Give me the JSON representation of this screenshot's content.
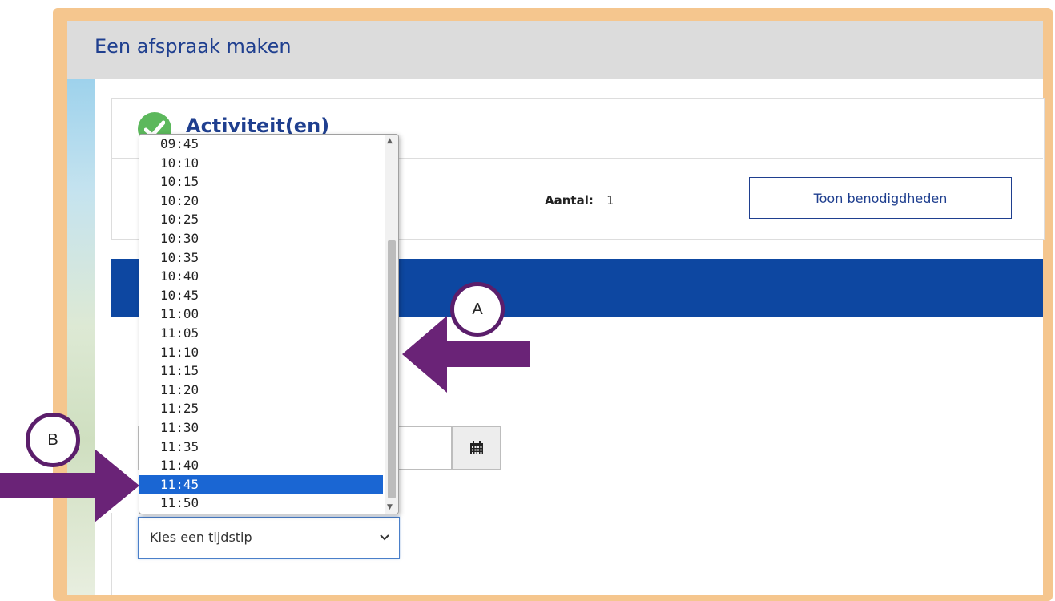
{
  "window": {
    "title": "Een afspraak maken"
  },
  "activities": {
    "title": "Activiteit(en)",
    "aantal_label": "Aantal:",
    "aantal_value": "1",
    "toon_button": "Toon benodigdheden"
  },
  "time_select": {
    "placeholder": "Kies een tijdstip",
    "options": [
      "09:45",
      "10:10",
      "10:15",
      "10:20",
      "10:25",
      "10:30",
      "10:35",
      "10:40",
      "10:45",
      "11:00",
      "11:05",
      "11:10",
      "11:15",
      "11:20",
      "11:25",
      "11:30",
      "11:35",
      "11:40",
      "11:45",
      "11:50"
    ],
    "highlighted": "11:45"
  },
  "annotations": {
    "marker_a": "A",
    "marker_b": "B"
  },
  "icons": {
    "check": "check-circle-icon",
    "calendar": "calendar-icon",
    "chevron": "chevron-down-icon"
  },
  "colors": {
    "frame": "#f5c68e",
    "title_text": "#1f3f8f",
    "blue_band": "#0d47a1",
    "highlight": "#1a66d3",
    "arrow": "#6a2377",
    "check": "#5cb85c"
  }
}
